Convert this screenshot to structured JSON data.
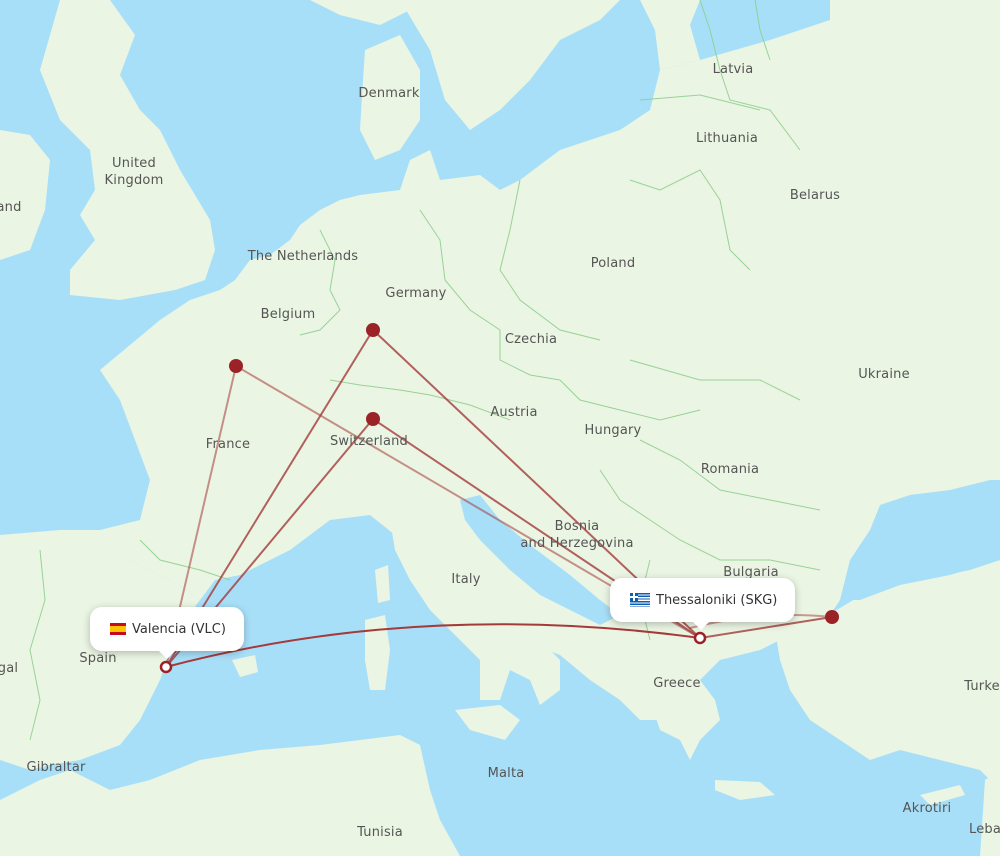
{
  "map": {
    "colors": {
      "water": "#a8dff8",
      "land": "#ebf5e3",
      "border": "#8fcf8f",
      "route": "#a33b3b",
      "marker": "#9b2226"
    },
    "country_labels": [
      {
        "name": "Latvia"
      },
      {
        "name": "Denmark"
      },
      {
        "name": "Lithuania"
      },
      {
        "name": "United Kingdom"
      },
      {
        "name": "Belarus"
      },
      {
        "name": "Ireland (partial)",
        "text": "and"
      },
      {
        "name": "The Netherlands"
      },
      {
        "name": "Poland"
      },
      {
        "name": "Germany"
      },
      {
        "name": "Belgium"
      },
      {
        "name": "Czechia"
      },
      {
        "name": "Ukraine"
      },
      {
        "name": "Austria"
      },
      {
        "name": "France"
      },
      {
        "name": "Hungary"
      },
      {
        "name": "Switzerland"
      },
      {
        "name": "Romania"
      },
      {
        "name": "Bosnia and Herzegovina"
      },
      {
        "name": "Bulgaria"
      },
      {
        "name": "Italy"
      },
      {
        "name": "Spain"
      },
      {
        "name": "Portugal (partial)",
        "text": "gal"
      },
      {
        "name": "Greece"
      },
      {
        "name": "Turkey (partial)",
        "text": "Turke"
      },
      {
        "name": "Gibraltar"
      },
      {
        "name": "Malta"
      },
      {
        "name": "Tunisia"
      },
      {
        "name": "Akrotiri"
      },
      {
        "name": "Lebanon (partial)",
        "text": "Leba"
      }
    ],
    "label_text": {
      "latvia": "Latvia",
      "denmark": "Denmark",
      "lithuania": "Lithuania",
      "uk1": "United",
      "uk2": "Kingdom",
      "belarus": "Belarus",
      "ireland": "and",
      "netherlands": "The Netherlands",
      "poland": "Poland",
      "germany": "Germany",
      "belgium": "Belgium",
      "czechia": "Czechia",
      "ukraine": "Ukraine",
      "austria": "Austria",
      "france": "France",
      "hungary": "Hungary",
      "switzerland": "Switzerland",
      "romania": "Romania",
      "bosnia1": "Bosnia",
      "bosnia2": "and Herzegovina",
      "bulgaria": "Bulgaria",
      "italy": "Italy",
      "spain": "Spain",
      "portugal": "gal",
      "greece": "Greece",
      "turkey": "Turke",
      "gibraltar": "Gibraltar",
      "malta": "Malta",
      "tunisia": "Tunisia",
      "akrotiri": "Akrotiri",
      "lebanon": "Leba"
    }
  },
  "airports": {
    "origin": {
      "label": "Valencia (VLC)",
      "flag": "spain-flag"
    },
    "destination": {
      "label": "Thessaloniki (SKG)",
      "flag": "greece-flag"
    }
  },
  "stopovers": [
    "Paris area",
    "Frankfurt area",
    "Zurich area",
    "Istanbul area"
  ]
}
